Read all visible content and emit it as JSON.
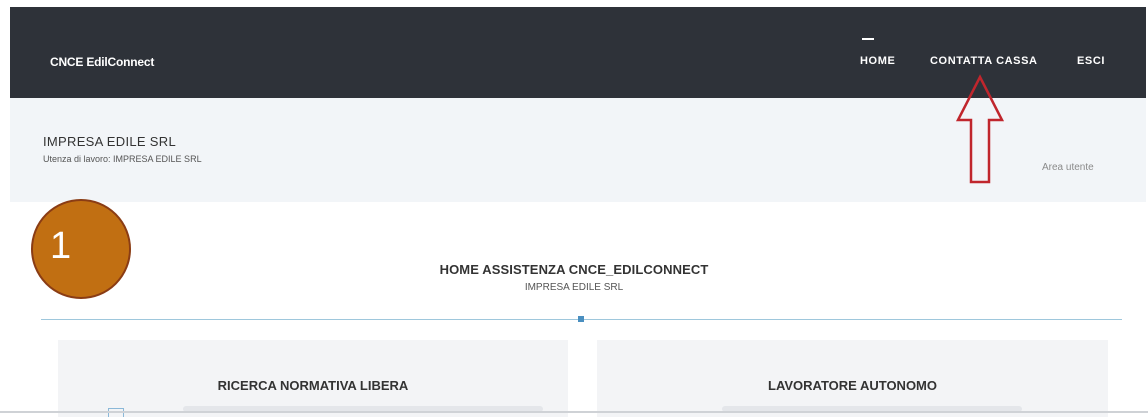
{
  "header": {
    "brand": "CNCE EdilConnect",
    "nav": [
      {
        "label": "HOME"
      },
      {
        "label": "CONTATTA CASSA"
      },
      {
        "label": "ESCI"
      }
    ]
  },
  "subheader": {
    "company": "IMPRESA EDILE SRL",
    "utenza": "Utenza di lavoro: IMPRESA EDILE SRL",
    "area_utente": "Area utente"
  },
  "annotation": {
    "step_number": "1"
  },
  "main": {
    "title": "HOME ASSISTENZA CNCE_EDILCONNECT",
    "subtitle": "IMPRESA EDILE SRL"
  },
  "cards": [
    {
      "title": "RICERCA NORMATIVA LIBERA"
    },
    {
      "title": "LAVORATORE AUTONOMO"
    }
  ],
  "colors": {
    "header_bg": "#2e3239",
    "subheader_bg": "#f2f5f8",
    "annotation_circle": "#c16f12",
    "annotation_arrow": "#c0262d",
    "divider": "#9ec7dc"
  }
}
